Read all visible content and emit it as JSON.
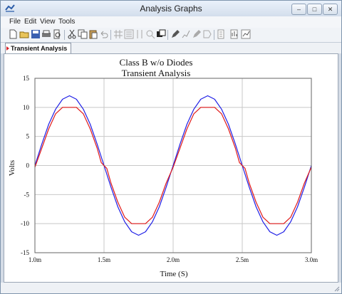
{
  "window": {
    "title": "Analysis Graphs"
  },
  "menu": [
    "File",
    "Edit",
    "View",
    "Tools"
  ],
  "tabs": [
    {
      "label": "Transient Analysis",
      "active": true
    }
  ],
  "chart_data": {
    "type": "line",
    "title": "Class B w/o Diodes",
    "subtitle": "Transient Analysis",
    "xlabel": "Time (S)",
    "ylabel": "Volts",
    "xlim": [
      0.001,
      0.003
    ],
    "ylim": [
      -15,
      15
    ],
    "xtick_values": [
      0.001,
      0.0015,
      0.002,
      0.0025,
      0.003
    ],
    "xtick_labels": [
      "1.0m",
      "1.5m",
      "2.0m",
      "2.5m",
      "3.0m"
    ],
    "yticks": [
      15,
      10,
      5,
      0,
      -5,
      -10,
      -15
    ],
    "grid": true,
    "series": [
      {
        "color": "#1f1fe6",
        "x": [
          0.001,
          0.00105,
          0.0011,
          0.00115,
          0.0012,
          0.00125,
          0.0013,
          0.00135,
          0.0014,
          0.00145,
          0.0015,
          0.00155,
          0.0016,
          0.00165,
          0.0017,
          0.00175,
          0.0018,
          0.00185,
          0.0019,
          0.00195,
          0.002,
          0.00205,
          0.0021,
          0.00215,
          0.0022,
          0.00225,
          0.0023,
          0.00235,
          0.0024,
          0.00245,
          0.0025,
          0.00255,
          0.0026,
          0.00265,
          0.0027,
          0.00275,
          0.0028,
          0.00285,
          0.0029,
          0.00295,
          0.003
        ],
        "y": [
          0,
          3.7,
          7.1,
          9.7,
          11.4,
          12,
          11.4,
          9.7,
          7.1,
          3.7,
          0,
          -3.7,
          -7.1,
          -9.7,
          -11.4,
          -12,
          -11.4,
          -9.7,
          -7.1,
          -3.7,
          0,
          3.7,
          7.1,
          9.7,
          11.4,
          12,
          11.4,
          9.7,
          7.1,
          3.7,
          0,
          -3.7,
          -7.1,
          -9.7,
          -11.4,
          -12,
          -11.4,
          -9.7,
          -7.1,
          -3.7,
          0
        ]
      },
      {
        "color": "#e01a1a",
        "x": [
          0.001,
          0.00105,
          0.0011,
          0.00115,
          0.0012,
          0.00125,
          0.0013,
          0.00135,
          0.0014,
          0.00145,
          0.00148,
          0.0015,
          0.00152,
          0.00155,
          0.0016,
          0.00165,
          0.0017,
          0.00175,
          0.0018,
          0.00185,
          0.0019,
          0.00195,
          0.002,
          0.00205,
          0.0021,
          0.00215,
          0.0022,
          0.00225,
          0.0023,
          0.00235,
          0.0024,
          0.00245,
          0.00248,
          0.0025,
          0.00252,
          0.00255,
          0.0026,
          0.00265,
          0.0027,
          0.00275,
          0.0028,
          0.00285,
          0.0029,
          0.00295,
          0.003
        ],
        "y": [
          -0.3,
          3.0,
          6.3,
          8.9,
          10,
          10,
          10,
          8.9,
          6.3,
          3.0,
          0.5,
          0,
          -0.5,
          -3.0,
          -6.3,
          -8.9,
          -10,
          -10,
          -10,
          -8.9,
          -6.3,
          -3.0,
          -0.3,
          3.0,
          6.3,
          8.9,
          10,
          10,
          10,
          8.9,
          6.3,
          3.0,
          0.5,
          0,
          -0.5,
          -3.0,
          -6.3,
          -8.9,
          -10,
          -10,
          -10,
          -8.9,
          -6.3,
          -3.0,
          -0.3
        ]
      }
    ]
  }
}
